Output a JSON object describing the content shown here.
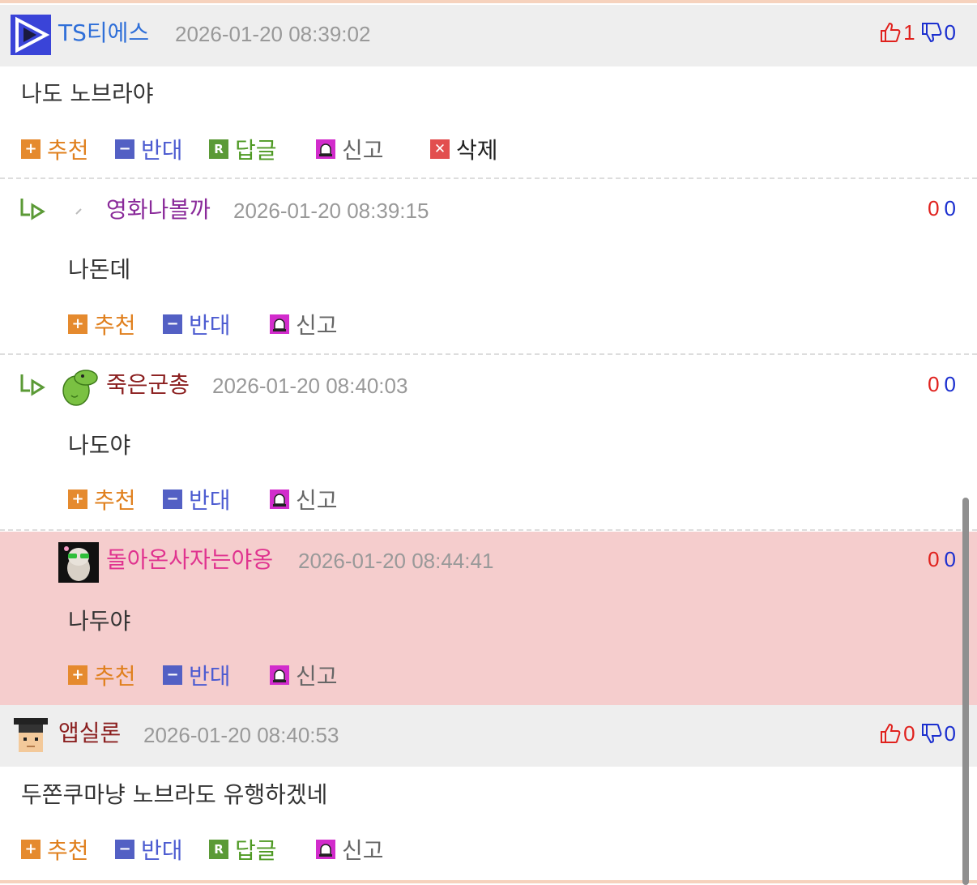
{
  "comments": [
    {
      "username": "TS티에스",
      "timestamp": "2026-01-20 08:39:02",
      "content": "나도 노브라야",
      "votes": {
        "up": "1",
        "down": "0"
      },
      "name_color": "#2f6fd8",
      "avatar_icon": "arrow-play-avatar",
      "actions": {
        "recommend": "추천",
        "oppose": "반대",
        "reply": "답글",
        "report": "신고",
        "delete": "삭제"
      }
    },
    {
      "username": "영화나볼까",
      "timestamp": "2026-01-20 08:39:15",
      "content": "나돈데",
      "votes": {
        "up": "0",
        "down": "0"
      },
      "name_color": "#8a2a9a",
      "avatar_icon": "pencil-avatar",
      "actions": {
        "recommend": "추천",
        "oppose": "반대",
        "report": "신고"
      }
    },
    {
      "username": "죽은군총",
      "timestamp": "2026-01-20 08:40:03",
      "content": "나도야",
      "votes": {
        "up": "0",
        "down": "0"
      },
      "name_color": "#8b1f1f",
      "avatar_icon": "green-dino-avatar",
      "actions": {
        "recommend": "추천",
        "oppose": "반대",
        "report": "신고"
      }
    },
    {
      "username": "돌아온사자는야옹",
      "timestamp": "2026-01-20 08:44:41",
      "content": "나두야",
      "votes": {
        "up": "0",
        "down": "0"
      },
      "name_color": "#e0338f",
      "avatar_icon": "cat-sunglasses-avatar",
      "actions": {
        "recommend": "추천",
        "oppose": "반대",
        "report": "신고"
      }
    },
    {
      "username": "앱실론",
      "timestamp": "2026-01-20 08:40:53",
      "content": "두쫀쿠마냥 노브라도 유행하겠네",
      "votes": {
        "up": "0",
        "down": "0"
      },
      "name_color": "#8b1f1f",
      "avatar_icon": "pixel-graduate-avatar",
      "actions": {
        "recommend": "추천",
        "oppose": "반대",
        "reply": "답글",
        "report": "신고"
      }
    }
  ],
  "colors": {
    "highlight_bg": "#f5cdcd",
    "header_bg": "#eeeeee",
    "vote_up": "#e0211d",
    "vote_down": "#1b2fcf"
  }
}
